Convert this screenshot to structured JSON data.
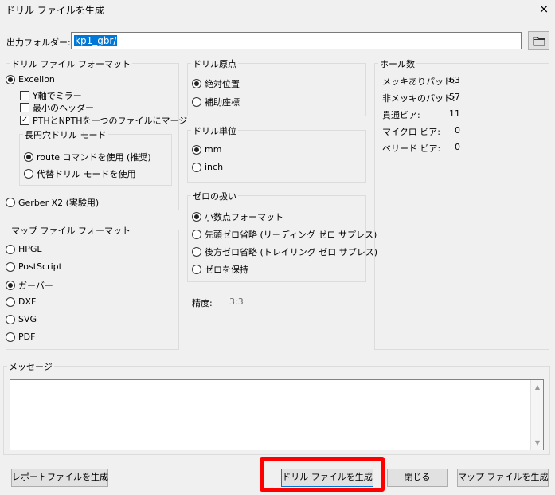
{
  "window": {
    "title": "ドリル ファイルを生成",
    "close": "×"
  },
  "output": {
    "label": "出力フォルダー:",
    "value": "kp1_gbr/"
  },
  "drill_format": {
    "title": "ドリル ファイル フォーマット",
    "excellon": "Excellon",
    "mirror_y": "Y軸でミラー",
    "minimal_header": "最小のヘッダー",
    "merge_pth_npth": "PTHとNPTHを一つのファイルにマージ",
    "oval_title": "長円穴ドリル モード",
    "route": "route コマンドを使用 (推奨)",
    "alt_drill": "代替ドリル モードを使用",
    "gerber_x2": "Gerber X2 (実験用)"
  },
  "map_format": {
    "title": "マップ ファイル フォーマット",
    "options": [
      "HPGL",
      "PostScript",
      "ガーバー",
      "DXF",
      "SVG",
      "PDF"
    ]
  },
  "drill_origin": {
    "title": "ドリル原点",
    "absolute": "絶対位置",
    "aux": "補助座標"
  },
  "drill_units": {
    "title": "ドリル単位",
    "mm": "mm",
    "inch": "inch"
  },
  "zeros": {
    "title": "ゼロの扱い",
    "decimal": "小数点フォーマット",
    "suppress_leading": "先頭ゼロ省略 (リーディング ゼロ サプレス)",
    "suppress_trailing": "後方ゼロ省略 (トレイリング ゼロ サプレス)",
    "keep": "ゼロを保持"
  },
  "precision": {
    "label": "精度:",
    "value": "3:3"
  },
  "hole_counts": {
    "title": "ホール数",
    "rows": [
      {
        "label": "メッキありパッド:",
        "value": "63"
      },
      {
        "label": "非メッキのパッド:",
        "value": "57"
      },
      {
        "label": "貫通ビア:",
        "value": "11"
      },
      {
        "label": "マイクロ ビア:",
        "value": "0"
      },
      {
        "label": "ベリード ビア:",
        "value": "0"
      }
    ]
  },
  "messages": {
    "title": "メッセージ"
  },
  "buttons": {
    "report": "レポートファイルを生成",
    "generate_drill": "ドリル ファイルを生成",
    "close": "閉じる",
    "generate_map": "マップ ファイルを生成"
  },
  "icons": {
    "folder": "folder-icon",
    "close": "close-icon"
  }
}
